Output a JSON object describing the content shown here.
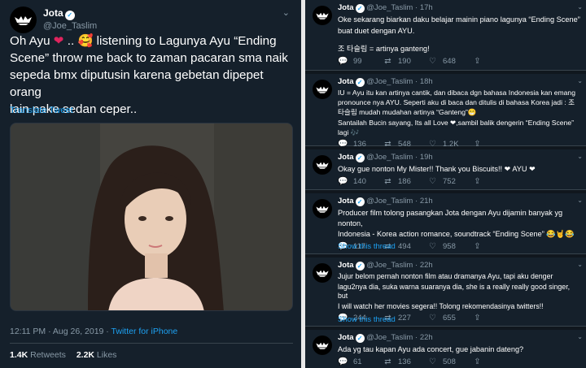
{
  "main_tweet": {
    "name": "Jota",
    "handle": "@Joe_Taslim",
    "text_line1": "Oh Ayu",
    "text_line1b": "..",
    "text_line1c": "listening to Lagunya Ayu “Ending",
    "text_line2": "Scene” throw me back to zaman pacaran sma naik",
    "text_line3": "sepeda bmx diputusin karena gebetan dipepet orang",
    "text_line4": "lain pake sedan ceper..",
    "translate": "Translate Tweet",
    "time": "12:11 PM · Aug 26, 2019 · ",
    "source": "Twitter for iPhone",
    "retweets_count": "1.4K",
    "retweets_label": "Retweets",
    "likes_count": "2.2K",
    "likes_label": "Likes"
  },
  "replies": [
    {
      "name": "Jota",
      "handle": "@Joe_Taslim",
      "time": "17h",
      "lines": [
        "Oke sekarang biarkan daku belajar mainin piano lagunya “Ending Scene”",
        "buat duet dengan AYU.",
        "",
        "조 타슬림 = artinya ganteng!"
      ],
      "reply": "99",
      "retweet": "190",
      "like": "648"
    },
    {
      "name": "Jota",
      "handle": "@Joe_Taslim",
      "time": "18h",
      "lines": [
        "IU = Ayu itu kan artinya cantik, dan dibaca dgn bahasa Indonesia kan emang",
        "pronounce nya AYU. Seperti aku di baca dan ditulis  di bahasa Korea jadi  : 조",
        "타슬림 mudah mudahan artinya “Ganteng”😁",
        "Santailah Bucin sayang, Its all Love ❤,sambil balik dengerin “Ending Scene”",
        "lagi 🎶"
      ],
      "reply": "136",
      "retweet": "548",
      "like": "1.2K"
    },
    {
      "name": "Jota",
      "handle": "@Joe_Taslim",
      "time": "19h",
      "lines": [
        "Okay gue nonton My Mister!! Thank you Biscuits!! ❤ AYU ❤"
      ],
      "reply": "140",
      "retweet": "186",
      "like": "752"
    },
    {
      "name": "Jota",
      "handle": "@Joe_Taslim",
      "time": "21h",
      "lines": [
        "Producer film tolong pasangkan Jota dengan Ayu dijamin banyak yg nonton,",
        "Indonesia - Korea action romance, soundtrack “Ending Scene” 😂🤘😂"
      ],
      "reply": "117",
      "retweet": "494",
      "like": "958",
      "show_thread": "Show this thread"
    },
    {
      "name": "Jota",
      "handle": "@Joe_Taslim",
      "time": "22h",
      "lines": [
        "Jujur belom pernah nonton film atau dramanya Ayu, tapi aku denger",
        "lagu2nya dia, suka warna suaranya dia, she is a really really good singer, but",
        "I will watch her movies segera!! Tolong rekomendasinya twitters!!"
      ],
      "reply": "244",
      "retweet": "227",
      "like": "655",
      "show_thread": "Show this thread"
    },
    {
      "name": "Jota",
      "handle": "@Joe_Taslim",
      "time": "22h",
      "lines": [
        "Ada yg tau kapan Ayu ada concert, gue jabanin dateng?"
      ],
      "reply": "61",
      "retweet": "136",
      "like": "508"
    }
  ],
  "colors": {
    "background": "#15202b",
    "accent": "#1da1f2",
    "muted": "#8899a6",
    "heart": "#e0245e"
  },
  "icons": {
    "reply": "reply-icon",
    "retweet": "retweet-icon",
    "like": "like-icon",
    "share": "share-icon",
    "caret": "chevron-down-icon",
    "verified": "verified-icon"
  }
}
